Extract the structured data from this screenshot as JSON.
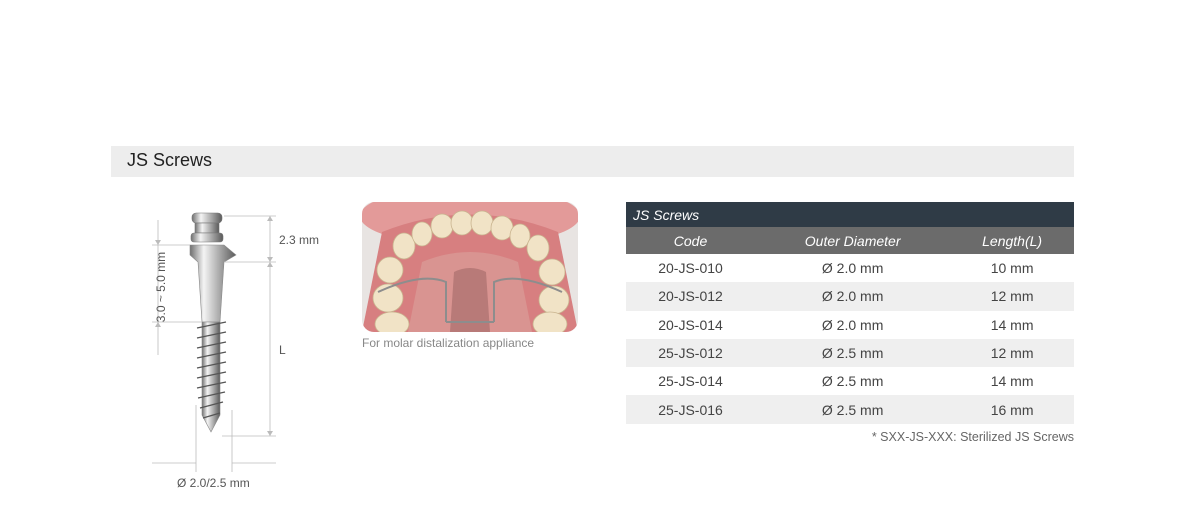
{
  "section": {
    "title": "JS Screws"
  },
  "diagram": {
    "head_height_label": "2.3 mm",
    "neck_range_label": "3.0 ~ 5.0 mm",
    "length_label": "L",
    "diameter_label": "Ø 2.0/2.5 mm"
  },
  "photo": {
    "caption": "For molar distalization appliance"
  },
  "table": {
    "title": "JS Screws",
    "headers": [
      "Code",
      "Outer Diameter",
      "Length(L)"
    ],
    "rows": [
      [
        "20-JS-010",
        "Ø 2.0 mm",
        "10 mm"
      ],
      [
        "20-JS-012",
        "Ø 2.0 mm",
        "12 mm"
      ],
      [
        "20-JS-014",
        "Ø 2.0 mm",
        "14 mm"
      ],
      [
        "25-JS-012",
        "Ø 2.5 mm",
        "12 mm"
      ],
      [
        "25-JS-014",
        "Ø 2.5 mm",
        "14 mm"
      ],
      [
        "25-JS-016",
        "Ø 2.5 mm",
        "16 mm"
      ]
    ],
    "footnote": "* SXX-JS-XXX: Sterilized JS Screws"
  },
  "colors": {
    "section_bar": "#ededed",
    "table_title_bg": "#2f3b46",
    "table_header_bg": "#6b6b6b",
    "row_stripe": "#efefef"
  }
}
